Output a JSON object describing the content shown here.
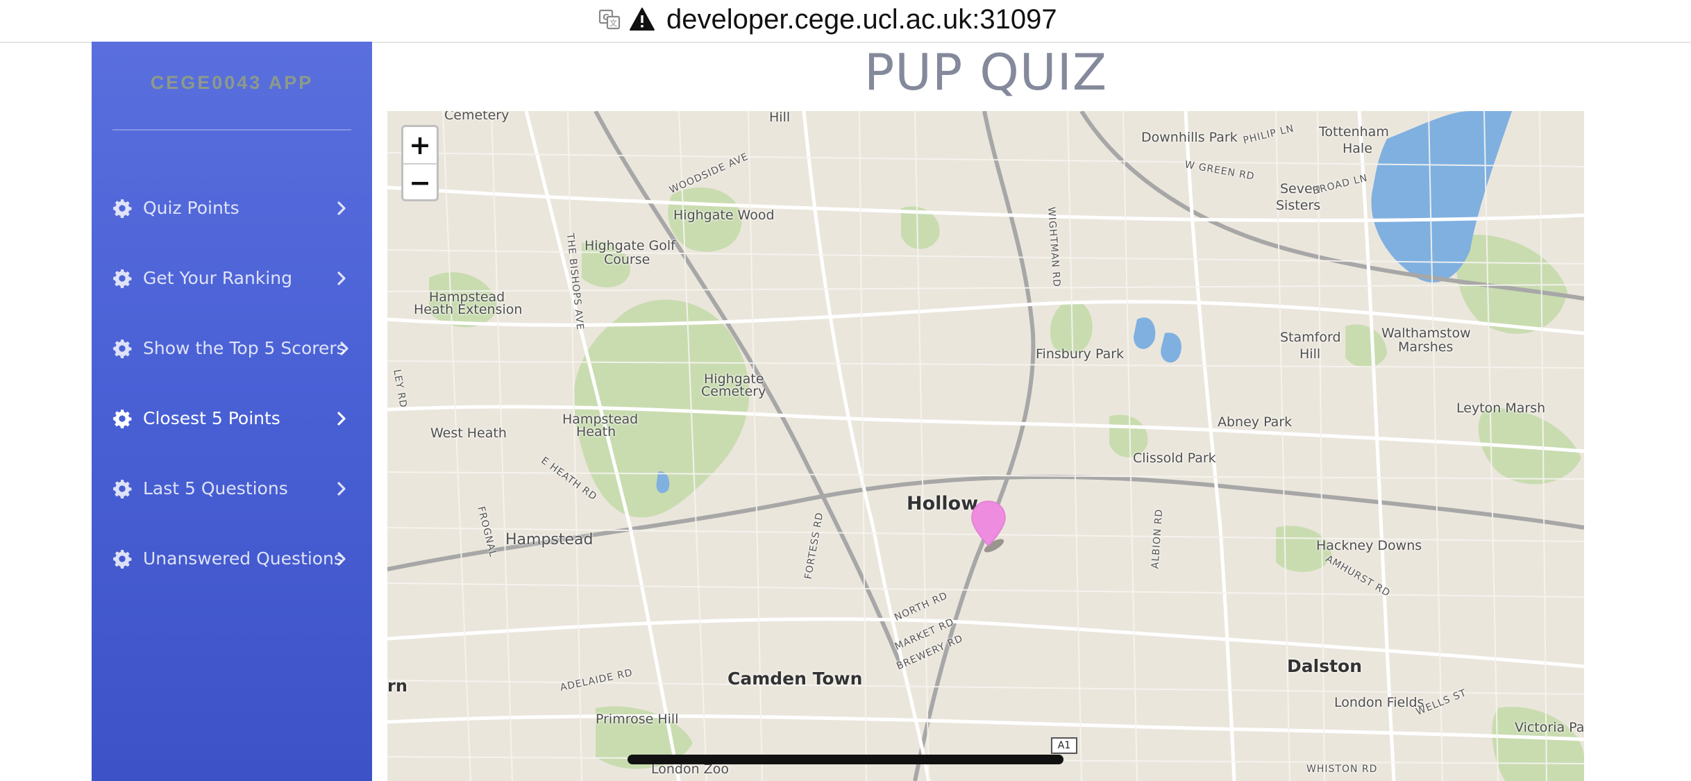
{
  "browser": {
    "url": "developer.cege.ucl.ac.uk:31097",
    "translate_icon": "translate-icon",
    "warning_icon": "warning-triangle-icon"
  },
  "sidebar": {
    "brand": "CEGE0043 APP",
    "items": [
      {
        "label": "Quiz Points",
        "icon": "gear-icon",
        "active": false
      },
      {
        "label": "Get Your Ranking",
        "icon": "gear-icon",
        "active": false
      },
      {
        "label": "Show the Top 5 Scorers",
        "icon": "gear-icon",
        "active": false
      },
      {
        "label": "Closest 5 Points",
        "icon": "gear-icon",
        "active": true
      },
      {
        "label": "Last 5 Questions",
        "icon": "gear-icon",
        "active": false
      },
      {
        "label": "Unanswered Questions",
        "icon": "gear-icon",
        "active": false
      }
    ]
  },
  "page": {
    "title": "PUP QUIZ"
  },
  "map": {
    "zoom_in_label": "+",
    "zoom_out_label": "−",
    "marker_color": "#ee8ce0",
    "road_badge": "A1",
    "labels": {
      "cemetery": "Cemetery",
      "hill": "Hill",
      "downhills": "Downhills Park",
      "philip_ln": "PHILIP LN",
      "tottenham": "Tottenham",
      "hale": "Hale",
      "woodside": "WOODSIDE AVE",
      "w_green": "W GREEN RD",
      "seven": "Seven",
      "sisters": "Sisters",
      "broad_ln": "BROAD LN",
      "highgate_wood": "Highgate Wood",
      "highgate_golf_1": "Highgate Golf",
      "highgate_golf_2": "Course",
      "the_bishops": "THE BISHOPS AVE",
      "wightman": "WIGHTMAN RD",
      "hampstead_heath_ext_1": "Hampstead",
      "hampstead_heath_ext_2": "Heath Extension",
      "finsbury_park": "Finsbury Park",
      "stamford_1": "Stamford",
      "stamford_2": "Hill",
      "walthamstow_1": "Walthamstow",
      "walthamstow_2": "Marshes",
      "highgate_cem_1": "Highgate",
      "highgate_cem_2": "Cemetery",
      "hampstead_heath_1": "Hampstead",
      "hampstead_heath_2": "Heath",
      "abney_park": "Abney Park",
      "leyton_marsh": "Leyton Marsh",
      "west_heath": "West Heath",
      "clissold_park": "Clissold Park",
      "e_heath_rd": "E HEATH RD",
      "holloway": "Hollow",
      "fortess_rd": "FORTESS RD",
      "albion_rd": "ALBION RD",
      "frognal": "FROGNAL",
      "hampstead": "Hampstead",
      "hackney_downs": "Hackney Downs",
      "amhurst_rd": "AMHURST RD",
      "north_rd": "NORTH RD",
      "market_rd": "MARKET RD",
      "brewery_rd": "BREWERY RD",
      "adelaide_rd": "ADELAIDE RD",
      "camden_town": "Camden Town",
      "dalston": "Dalston",
      "rn": "rn",
      "primrose_hill": "Primrose Hill",
      "london_fields": "London Fields",
      "wells_st": "WELLS ST",
      "victoria_park": "Victoria Pa",
      "london_zoo": "London Zoo",
      "whiston_rd": "WHISTON RD",
      "ley_rd": "LEY RD"
    }
  }
}
